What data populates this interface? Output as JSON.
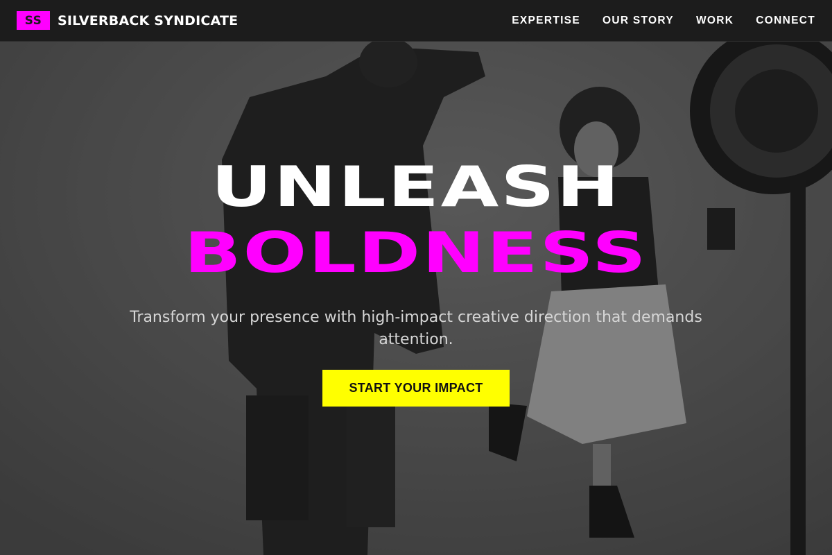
{
  "header": {
    "logo_mark": "SS",
    "brand_name": "SILVERBACK SYNDICATE",
    "nav": [
      {
        "label": "EXPERTISE"
      },
      {
        "label": "OUR STORY"
      },
      {
        "label": "WORK"
      },
      {
        "label": "CONNECT"
      }
    ]
  },
  "hero": {
    "headline_line1": "UNLEASH",
    "headline_line2": "BOLDNESS",
    "subcopy": "Transform your presence with high-impact creative direction that demands attention.",
    "cta_label": "START YOUR IMPACT"
  },
  "colors": {
    "accent_magenta": "#ff00ff",
    "cta_yellow": "#ffff00",
    "header_bg": "#1c1c1c"
  }
}
